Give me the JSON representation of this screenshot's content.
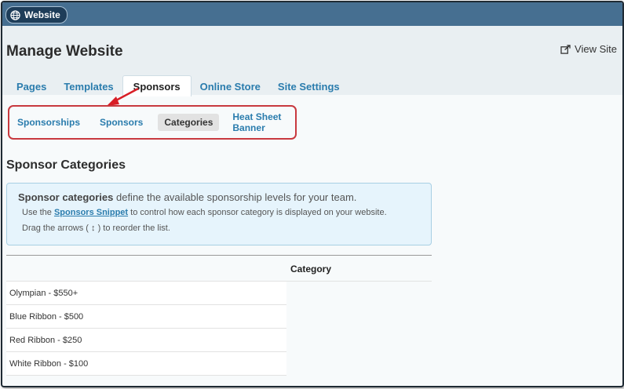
{
  "site_badge": {
    "label": "Website"
  },
  "header": {
    "title": "Manage Website",
    "view_site": "View Site"
  },
  "tabs": [
    {
      "label": "Pages"
    },
    {
      "label": "Templates"
    },
    {
      "label": "Sponsors",
      "active": true
    },
    {
      "label": "Online Store"
    },
    {
      "label": "Site Settings"
    }
  ],
  "subnav": [
    {
      "label": "Sponsorships"
    },
    {
      "label": "Sponsors"
    },
    {
      "label": "Categories",
      "active": true
    },
    {
      "label": "Heat Sheet Banner"
    }
  ],
  "section_title": "Sponsor Categories",
  "info": {
    "line1_bold": "Sponsor categories",
    "line1_rest": " define the available sponsorship levels for your team.",
    "line2_pre": "Use the ",
    "line2_link": "Sponsors Snippet",
    "line2_post": " to control how each sponsor category is displayed on your website.",
    "line3_pre": "Drag the arrows ( ",
    "line3_symbol": "↕",
    "line3_post": " ) to reorder the list."
  },
  "table": {
    "header": "Category",
    "rows": [
      {
        "label": "Olympian - $550+"
      },
      {
        "label": "Blue Ribbon - $500"
      },
      {
        "label": "Red Ribbon - $250"
      },
      {
        "label": "White Ribbon - $100"
      }
    ]
  },
  "colors": {
    "topbar": "#466f91",
    "accent": "#2a7cad",
    "highlight_border": "#c8393f"
  },
  "icons": {
    "badge": "globe-icon",
    "view_site": "external-link-icon",
    "annotation": "red-arrow"
  }
}
